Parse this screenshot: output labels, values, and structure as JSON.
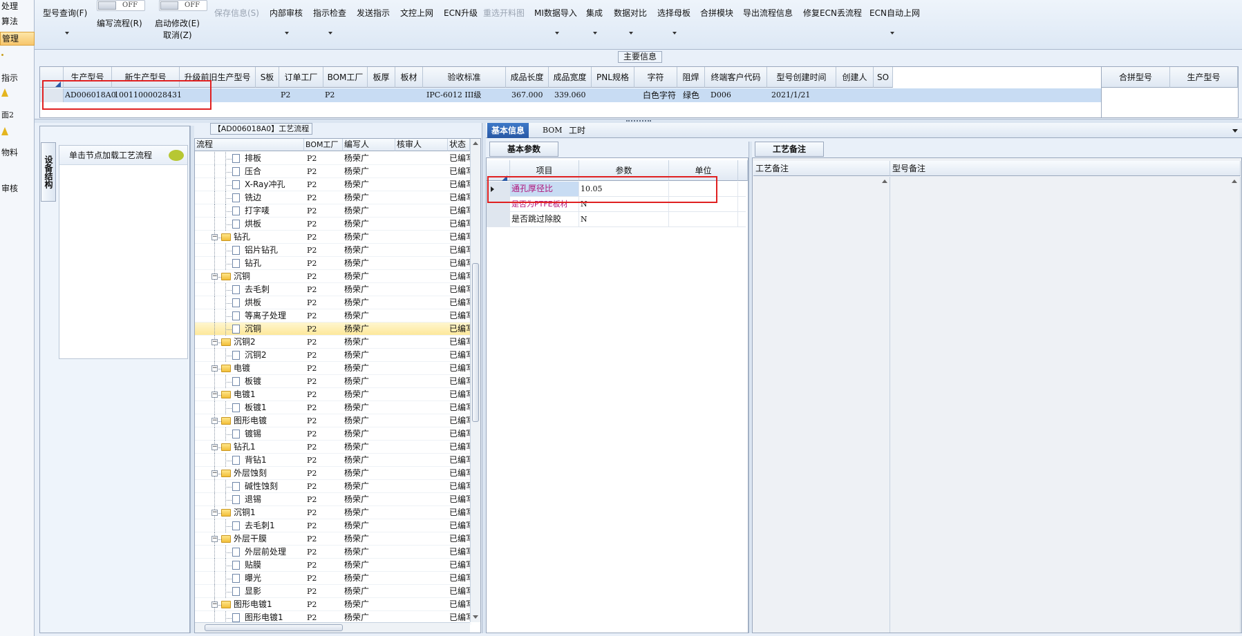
{
  "left_nav": {
    "items": [
      {
        "label": "处理"
      },
      {
        "label": "算法"
      },
      {
        "label": "管理",
        "active": true
      },
      {
        "label": "指示"
      },
      {
        "label": "面2"
      },
      {
        "label": "物料"
      },
      {
        "label": "审核"
      }
    ]
  },
  "toolbar": {
    "model_query": "型号查询(F)",
    "write_flow": "编写流程(R)",
    "write_flow_toggle": "OFF",
    "start_modify": "启动修改(E)",
    "start_modify_toggle": "OFF",
    "cancel": "取消(Z)",
    "save_info": "保存信息(S)",
    "internal_review": "内部审核",
    "instruction_check": "指示检查",
    "send_instruction": "发送指示",
    "doc_upload": "文控上网",
    "ecn_upgrade": "ECN升级",
    "reselect_cut_chart": "重选开料图",
    "mi_data_import": "MI数据导入",
    "integrate": "集成",
    "data_compare": "数据对比",
    "select_mother_board": "选择母板",
    "merge_module": "合拼模块",
    "export_flow_info": "导出流程信息",
    "fix_ecn_lost_flow": "修复ECN丢流程",
    "ecn_auto_upload": "ECN自动上网"
  },
  "main_info": {
    "legend": "主要信息",
    "columns": [
      "生产型号",
      "新生产型号",
      "升级前旧生产型号",
      "S板",
      "订单工厂",
      "BOM工厂",
      "板厚",
      "板材",
      "验收标准",
      "成品长度",
      "成品宽度",
      "PNL规格",
      "字符",
      "阻焊",
      "终端客户代码",
      "型号创建时间",
      "创建人",
      "SO"
    ],
    "extra_columns": [
      "合拼型号",
      "生产型号"
    ],
    "row": {
      "prod_model": "AD006018A0",
      "new_prod_model": "10011000028431",
      "order_factory": "P2",
      "bom_factory": "P2",
      "acceptance": "IPC-6012 III级",
      "length": "367.000",
      "width": "339.060",
      "silkscreen": "白色字符",
      "solder_mask": "绿色",
      "customer_code": "D006",
      "created": "2021/1/21"
    }
  },
  "structure_panel": {
    "tab": "设备结构",
    "load_hint": "单击节点加载工艺流程"
  },
  "process_flow": {
    "legend": "【AD006018A0】工艺流程",
    "columns": [
      "流程",
      "BOM工厂",
      "编写人",
      "核审人",
      "状态"
    ],
    "rows": [
      {
        "name": "排板",
        "level": 1,
        "factory": "P2",
        "author": "杨荣广",
        "status": "已编写"
      },
      {
        "name": "压合",
        "level": 1,
        "factory": "P2",
        "author": "杨荣广",
        "status": "已编写"
      },
      {
        "name": "X-Ray冲孔",
        "level": 1,
        "factory": "P2",
        "author": "杨荣广",
        "status": "已编写"
      },
      {
        "name": "铣边",
        "level": 1,
        "factory": "P2",
        "author": "杨荣广",
        "status": "已编写"
      },
      {
        "name": "打字唛",
        "level": 1,
        "factory": "P2",
        "author": "杨荣广",
        "status": "已编写"
      },
      {
        "name": "烘板",
        "level": 1,
        "factory": "P2",
        "author": "杨荣广",
        "status": "已编写"
      },
      {
        "name": "钻孔",
        "level": 0,
        "factory": "P2",
        "author": "杨荣广",
        "status": "已编写"
      },
      {
        "name": "铝片钻孔",
        "level": 1,
        "factory": "P2",
        "author": "杨荣广",
        "status": "已编写"
      },
      {
        "name": "钻孔",
        "level": 1,
        "factory": "P2",
        "author": "杨荣广",
        "status": "已编写"
      },
      {
        "name": "沉铜",
        "level": 0,
        "factory": "P2",
        "author": "杨荣广",
        "status": "已编写"
      },
      {
        "name": "去毛刺",
        "level": 1,
        "factory": "P2",
        "author": "杨荣广",
        "status": "已编写"
      },
      {
        "name": "烘板",
        "level": 1,
        "factory": "P2",
        "author": "杨荣广",
        "status": "已编写"
      },
      {
        "name": "等离子处理",
        "level": 1,
        "factory": "P2",
        "author": "杨荣广",
        "status": "已编写"
      },
      {
        "name": "沉铜",
        "level": 1,
        "factory": "P2",
        "author": "杨荣广",
        "status": "已编写",
        "selected": true
      },
      {
        "name": "沉铜2",
        "level": 0,
        "factory": "P2",
        "author": "杨荣广",
        "status": "已编写"
      },
      {
        "name": "沉铜2",
        "level": 1,
        "factory": "P2",
        "author": "杨荣广",
        "status": "已编写"
      },
      {
        "name": "电镀",
        "level": 0,
        "factory": "P2",
        "author": "杨荣广",
        "status": "已编写"
      },
      {
        "name": "板镀",
        "level": 1,
        "factory": "P2",
        "author": "杨荣广",
        "status": "已编写"
      },
      {
        "name": "电镀1",
        "level": 0,
        "factory": "P2",
        "author": "杨荣广",
        "status": "已编写"
      },
      {
        "name": "板镀1",
        "level": 1,
        "factory": "P2",
        "author": "杨荣广",
        "status": "已编写"
      },
      {
        "name": "图形电镀",
        "level": 0,
        "factory": "P2",
        "author": "杨荣广",
        "status": "已编写"
      },
      {
        "name": "镀锡",
        "level": 1,
        "factory": "P2",
        "author": "杨荣广",
        "status": "已编写"
      },
      {
        "name": "钻孔1",
        "level": 0,
        "factory": "P2",
        "author": "杨荣广",
        "status": "已编写"
      },
      {
        "name": "背钻1",
        "level": 1,
        "factory": "P2",
        "author": "杨荣广",
        "status": "已编写"
      },
      {
        "name": "外层蚀刻",
        "level": 0,
        "factory": "P2",
        "author": "杨荣广",
        "status": "已编写"
      },
      {
        "name": "碱性蚀刻",
        "level": 1,
        "factory": "P2",
        "author": "杨荣广",
        "status": "已编写"
      },
      {
        "name": "退锡",
        "level": 1,
        "factory": "P2",
        "author": "杨荣广",
        "status": "已编写"
      },
      {
        "name": "沉铜1",
        "level": 0,
        "factory": "P2",
        "author": "杨荣广",
        "status": "已编写"
      },
      {
        "name": "去毛刺1",
        "level": 1,
        "factory": "P2",
        "author": "杨荣广",
        "status": "已编写"
      },
      {
        "name": "外层干膜",
        "level": 0,
        "factory": "P2",
        "author": "杨荣广",
        "status": "已编写"
      },
      {
        "name": "外层前处理",
        "level": 1,
        "factory": "P2",
        "author": "杨荣广",
        "status": "已编写"
      },
      {
        "name": "贴膜",
        "level": 1,
        "factory": "P2",
        "author": "杨荣广",
        "status": "已编写"
      },
      {
        "name": "曝光",
        "level": 1,
        "factory": "P2",
        "author": "杨荣广",
        "status": "已编写"
      },
      {
        "name": "显影",
        "level": 1,
        "factory": "P2",
        "author": "杨荣广",
        "status": "已编写"
      },
      {
        "name": "图形电镀1",
        "level": 0,
        "factory": "P2",
        "author": "杨荣广",
        "status": "已编写"
      },
      {
        "name": "图形电镀1",
        "level": 1,
        "factory": "P2",
        "author": "杨荣广",
        "status": "已编写"
      }
    ]
  },
  "right_tabs": [
    {
      "label": "基本信息",
      "active": true
    },
    {
      "label": "BOM"
    },
    {
      "label": "工时"
    }
  ],
  "basic_params": {
    "label": "基本参数",
    "columns": [
      "项目",
      "参数",
      "单位"
    ],
    "rows": [
      {
        "item": "通孔厚径比",
        "value": "10.05",
        "unit": ""
      },
      {
        "item": "是否为PTFE板材",
        "value": "N",
        "unit": ""
      },
      {
        "item": "是否跳过除胶",
        "value": "N",
        "unit": ""
      }
    ]
  },
  "remarks": {
    "label": "工艺备注",
    "process_remark": "工艺备注",
    "model_remark": "型号备注"
  },
  "colors": {
    "accent": "#2858a5",
    "highlight_red": "#e02020",
    "row_blue": "#c8dcf3",
    "selected_yellow": "#fde89a",
    "param_magenta": "#b0137a"
  }
}
